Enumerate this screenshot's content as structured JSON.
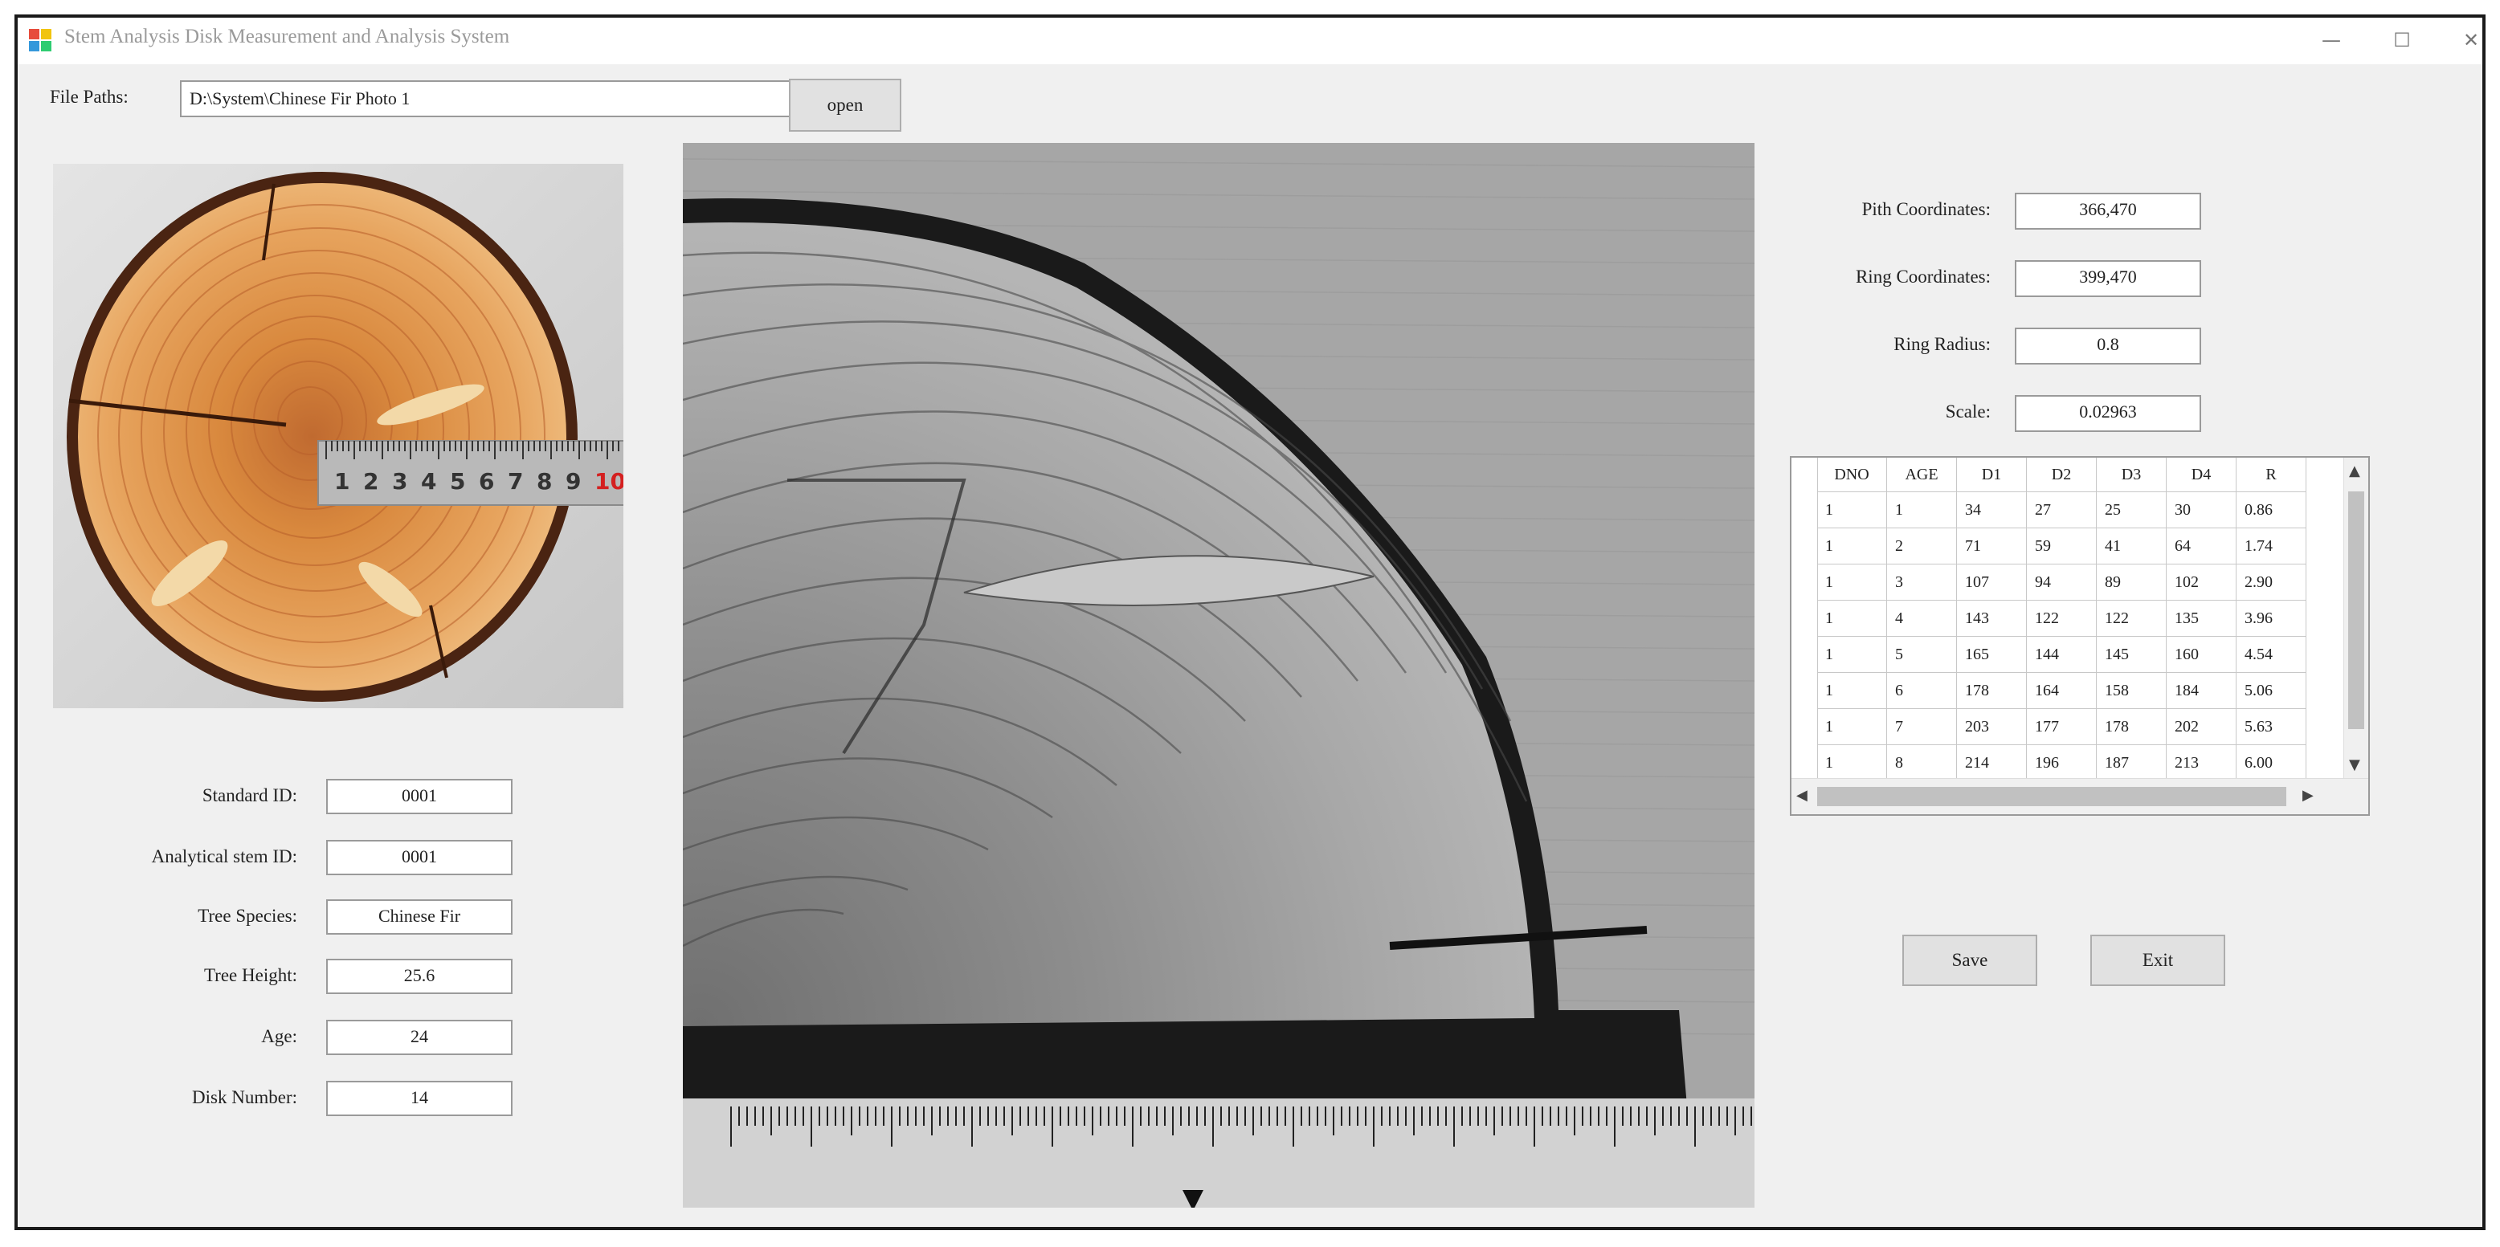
{
  "window": {
    "title": "Stem Analysis Disk Measurement and Analysis System"
  },
  "window_controls": {
    "minimize": "—",
    "maximize": "☐",
    "close": "✕"
  },
  "file": {
    "label": "File Paths:",
    "path": "D:\\System\\Chinese Fir Photo 1",
    "open_label": "open"
  },
  "left_fields": [
    {
      "label": "Standard ID:",
      "value": "0001"
    },
    {
      "label": "Analytical stem ID:",
      "value": "0001"
    },
    {
      "label": "Tree Species:",
      "value": "Chinese Fir"
    },
    {
      "label": "Tree Height:",
      "value": "25.6"
    },
    {
      "label": "Age:",
      "value": "24"
    },
    {
      "label": "Disk Number:",
      "value": "14"
    }
  ],
  "right_fields": [
    {
      "label": "Pith Coordinates:",
      "value": "366,470"
    },
    {
      "label": "Ring Coordinates:",
      "value": "399,470"
    },
    {
      "label": "Ring Radius:",
      "value": "0.8"
    },
    {
      "label": "Scale:",
      "value": "0.02963"
    }
  ],
  "table": {
    "columns": [
      "DNO",
      "AGE",
      "D1",
      "D2",
      "D3",
      "D4",
      "R"
    ],
    "rows": [
      [
        "1",
        "1",
        "34",
        "27",
        "25",
        "30",
        "0.86"
      ],
      [
        "1",
        "2",
        "71",
        "59",
        "41",
        "64",
        "1.74"
      ],
      [
        "1",
        "3",
        "107",
        "94",
        "89",
        "102",
        "2.90"
      ],
      [
        "1",
        "4",
        "143",
        "122",
        "122",
        "135",
        "3.96"
      ],
      [
        "1",
        "5",
        "165",
        "144",
        "145",
        "160",
        "4.54"
      ],
      [
        "1",
        "6",
        "178",
        "164",
        "158",
        "184",
        "5.06"
      ],
      [
        "1",
        "7",
        "203",
        "177",
        "178",
        "202",
        "5.63"
      ],
      [
        "1",
        "8",
        "214",
        "196",
        "187",
        "213",
        "6.00"
      ]
    ]
  },
  "buttons": {
    "save": "Save",
    "exit": "Exit"
  },
  "ruler_numbers": [
    "1",
    "2",
    "3",
    "4",
    "5",
    "6",
    "7",
    "8",
    "9",
    "10"
  ],
  "icons": {
    "app": "app-icon",
    "scroll_up": "▲",
    "scroll_down": "▼",
    "scroll_left": "◀",
    "scroll_right": "▶"
  }
}
